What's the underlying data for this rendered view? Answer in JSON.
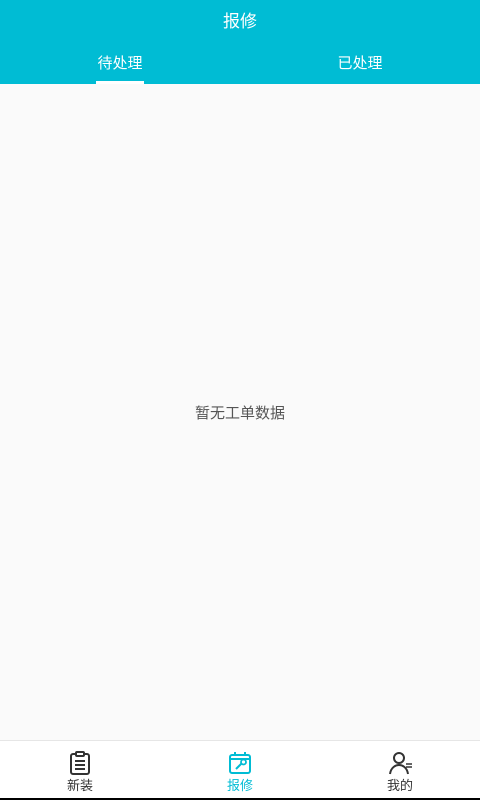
{
  "header": {
    "title": "报修",
    "tabs": [
      {
        "label": "待处理",
        "active": true
      },
      {
        "label": "已处理",
        "active": false
      }
    ]
  },
  "content": {
    "empty_message": "暂无工单数据"
  },
  "bottom_nav": [
    {
      "label": "新装",
      "icon": "clipboard-icon",
      "active": false
    },
    {
      "label": "报修",
      "icon": "repair-icon",
      "active": true
    },
    {
      "label": "我的",
      "icon": "profile-icon",
      "active": false
    }
  ],
  "colors": {
    "accent": "#00bcd4",
    "background": "#fafafa",
    "text": "#333333"
  }
}
